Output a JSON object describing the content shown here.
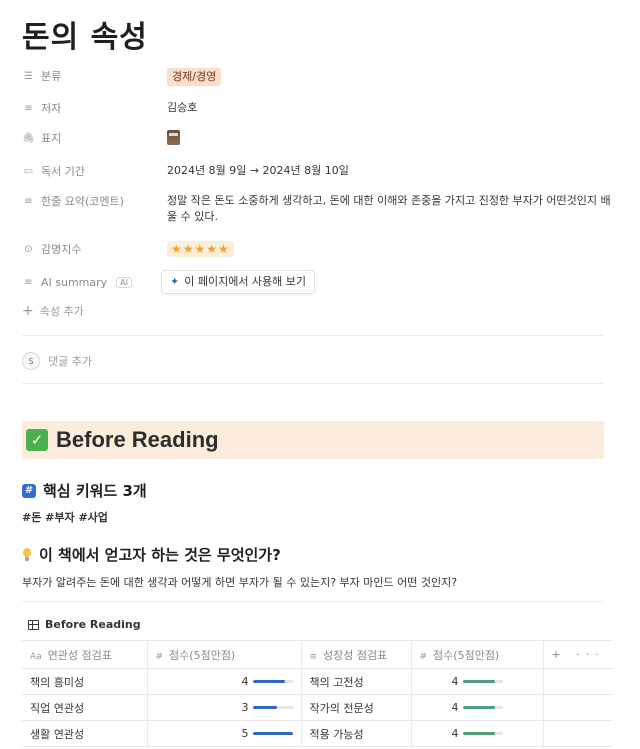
{
  "title": "돈의 속성",
  "properties": {
    "category": {
      "label": "분류",
      "value": "경제/경영"
    },
    "author": {
      "label": "저자",
      "value": "김승호"
    },
    "cover": {
      "label": "표지"
    },
    "period": {
      "label": "독서 기간",
      "value": "2024년 8월 9일 → 2024년 8월 10일"
    },
    "summary": {
      "label": "한줄 요약(코멘트)",
      "value": "정말 작은 돈도 소중하게 생각하고, 돈에 대한 이해와 존중을 가지고 진정한 부자가 어떤것인지 배울 수 있다."
    },
    "impression": {
      "label": "감명지수",
      "value": "★★★★★",
      "rating": 5
    },
    "ai_summary": {
      "label": "AI summary",
      "chip": "AI",
      "button": "이 페이지에서 사용해 보기"
    },
    "add_property": "속성 추가"
  },
  "comment": {
    "avatar": "S",
    "placeholder": "댓글 추가"
  },
  "callout": {
    "title": "Before Reading"
  },
  "section1": {
    "title": "핵심 키워드 3개",
    "text": "#돈 #부자 #사업"
  },
  "section2": {
    "title": "이 책에서 얻고자 하는 것은 무엇인가?",
    "text": "부자가 알려주는 돈에 대한 생각과 어떻게 하면 부자가 될 수 있는지? 부자 마인드 어떤 것인지?"
  },
  "database": {
    "title": "Before Reading",
    "columns": [
      "연관성 점검표",
      "점수(5점만점)",
      "성장성 점검표",
      "점수(5점만점)"
    ],
    "column_icons": [
      "Aa",
      "#",
      "≡",
      "#"
    ],
    "add_column": "+",
    "more": "···",
    "rows": [
      {
        "relevance": "책의 흥미성",
        "score1": 4,
        "growth": "책의 고전성",
        "score2": 4
      },
      {
        "relevance": "직업 연관성",
        "score1": 3,
        "growth": "작가의 전문성",
        "score2": 4
      },
      {
        "relevance": "생활 연관성",
        "score1": 5,
        "growth": "적용 가능성",
        "score2": 4
      }
    ],
    "score_max": 5
  }
}
